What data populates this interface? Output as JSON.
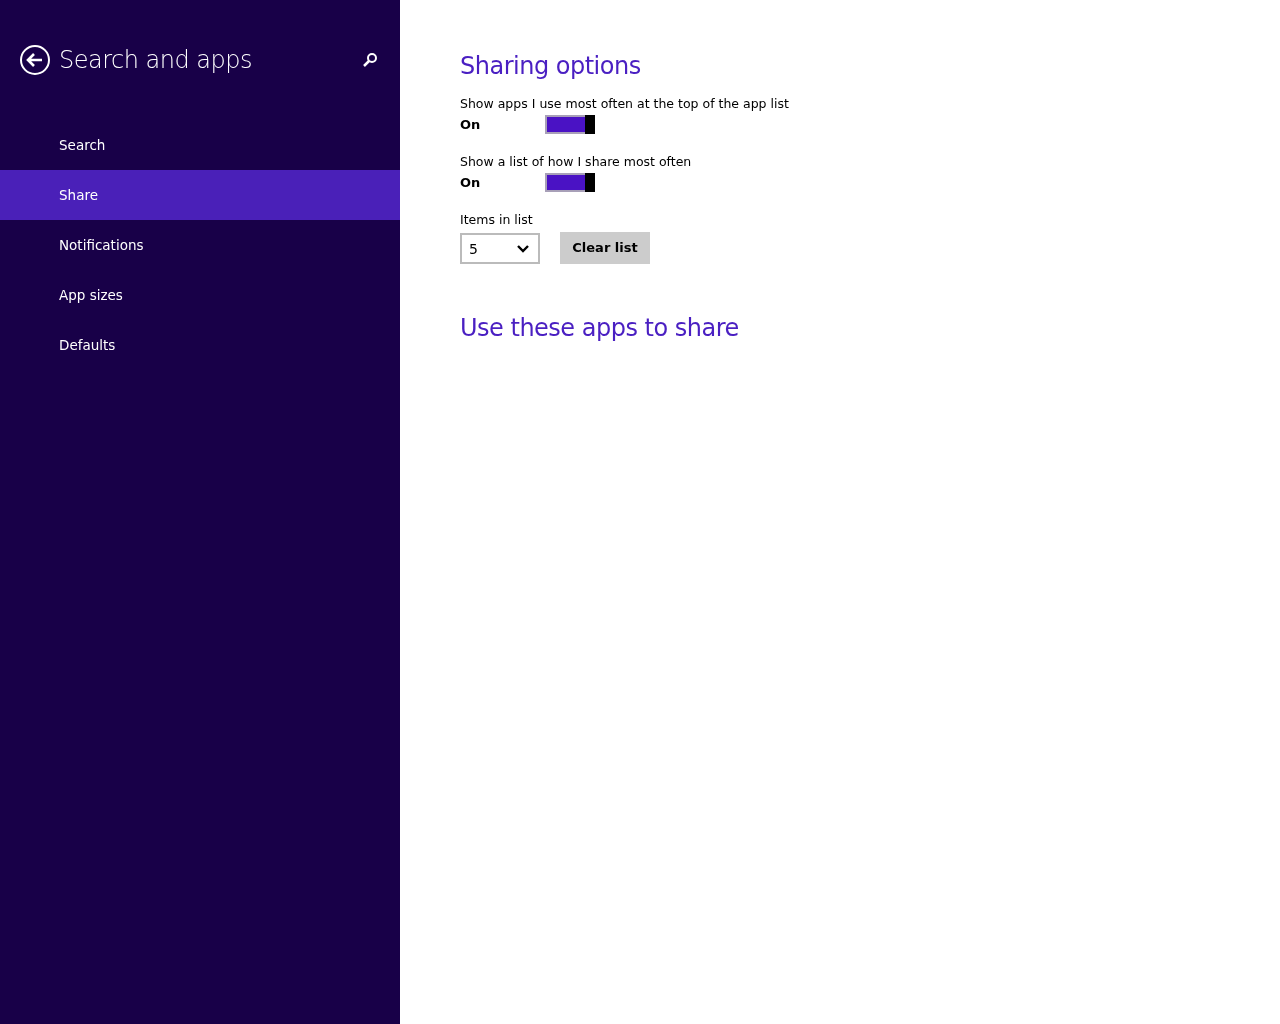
{
  "sidebar": {
    "title": "Search and apps",
    "items": [
      {
        "label": "Search",
        "selected": false
      },
      {
        "label": "Share",
        "selected": true
      },
      {
        "label": "Notifications",
        "selected": false
      },
      {
        "label": "App sizes",
        "selected": false
      },
      {
        "label": "Defaults",
        "selected": false
      }
    ]
  },
  "sections": [
    {
      "heading": "Sharing options",
      "settings": [
        {
          "kind": "toggle",
          "label": "Show apps I use most often at the top of the app list",
          "state_text": "On",
          "on": true
        },
        {
          "kind": "toggle",
          "label": "Show a list of how I share most often",
          "state_text": "On",
          "on": true
        },
        {
          "kind": "dropdown",
          "label": "Items in list",
          "value": "5",
          "button": "Clear list"
        }
      ]
    },
    {
      "heading": "Use these apps to share"
    }
  ]
}
